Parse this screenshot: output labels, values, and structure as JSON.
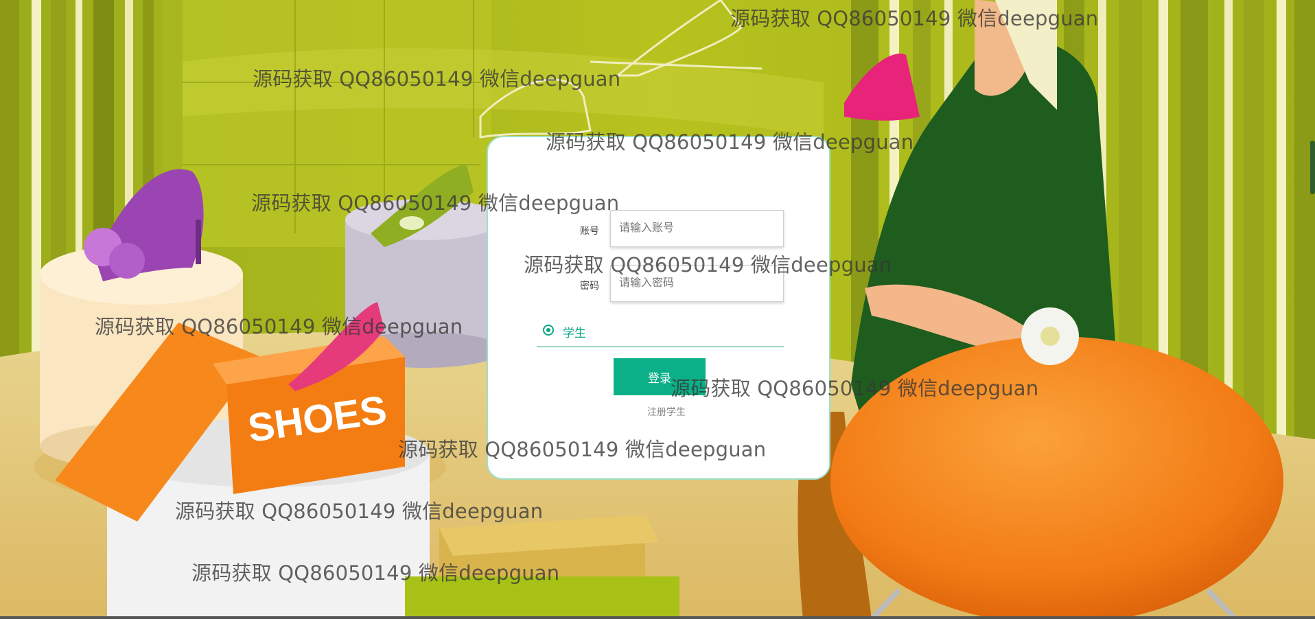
{
  "login": {
    "account_label": "账号",
    "account_placeholder": "请输入账号",
    "password_label": "密码",
    "password_placeholder": "请输入密码",
    "role_option": "学生",
    "login_button": "登录",
    "register_link": "注册学生"
  },
  "background": {
    "box_text": "SHOES"
  },
  "watermarks": [
    "源码获取 QQ86050149 微信deepguan",
    "源码获取 QQ86050149 微信deepguan",
    "源码获取 QQ86050149 微信deepguan",
    "源码获取 QQ86050149 微信deepguan",
    "源码获取 QQ86050149 微信deepguan",
    "源码获取 QQ86050149 微信deepguan",
    "源码获取 QQ86050149 微信deepguan",
    "源码获取 QQ86050149 微信deepguan",
    "源码获取 QQ86050149 微信deepguan",
    "源码获取 QQ86050149 微信deepguan"
  ],
  "colors": {
    "accent": "#0cb088",
    "card_border": "#9fe0c9",
    "wall_green": "#a9b81a",
    "floor": "#e9d08a",
    "ottoman": "#f07a1a"
  }
}
